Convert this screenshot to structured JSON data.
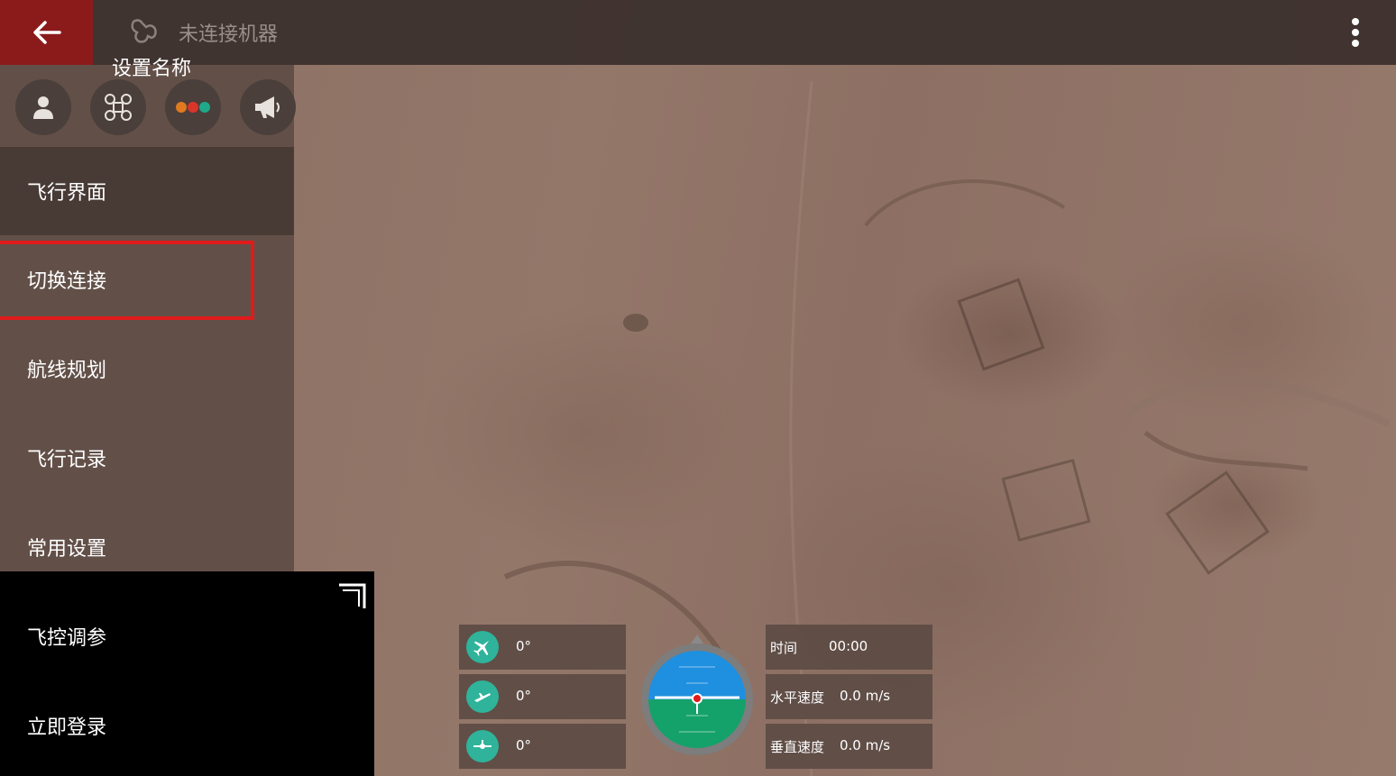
{
  "topbar": {
    "back_icon": "back-arrow-icon",
    "status_icon": "drone-icon",
    "connection_status": "未连接机器",
    "menu_icon": "more-vert-icon"
  },
  "drawer": {
    "profile_name": "设置名称",
    "quick_buttons": [
      {
        "icon": "user-icon"
      },
      {
        "icon": "drone-frame-icon"
      },
      {
        "icon": "dots-icon",
        "colors": [
          "#e07a1f",
          "#d9352b",
          "#1fa889"
        ]
      },
      {
        "icon": "megaphone-icon"
      }
    ],
    "items": [
      {
        "label": "飞行界面"
      },
      {
        "label": "切换连接"
      },
      {
        "label": "航线规划"
      },
      {
        "label": "飞行记录"
      },
      {
        "label": "常用设置"
      },
      {
        "label": "飞控调参"
      },
      {
        "label": "立即登录"
      }
    ],
    "highlight_color": "#e01b1b"
  },
  "telemetry": {
    "angles": [
      {
        "icon": "yaw-plane-icon",
        "value": "0°"
      },
      {
        "icon": "pitch-plane-icon",
        "value": "0°"
      },
      {
        "icon": "roll-plane-icon",
        "value": "0°"
      }
    ],
    "info": [
      {
        "label": "时间",
        "value": "00:00"
      },
      {
        "label": "水平速度",
        "value": "0.0 m/s"
      },
      {
        "label": "垂直速度",
        "value": "0.0 m/s"
      }
    ],
    "accent_color": "#2fb39a"
  }
}
